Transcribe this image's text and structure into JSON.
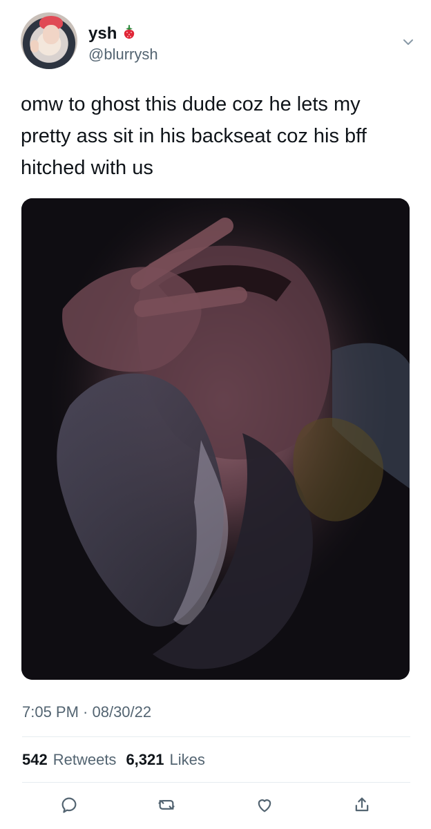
{
  "tweet": {
    "author": {
      "display_name": "ysh",
      "handle": "@blurrysh",
      "name_emoji": "🍓"
    },
    "text": "omw to ghost this dude coz he lets my pretty ass sit in his backseat coz his bff hitched with us",
    "timestamp": "7:05 PM · 08/30/22",
    "stats": {
      "retweets_count": "542",
      "retweets_label": "Retweets",
      "likes_count": "6,321",
      "likes_label": "Likes"
    },
    "actions": {
      "icons": [
        "reply-icon",
        "retweet-icon",
        "like-icon",
        "share-icon"
      ]
    }
  },
  "colors": {
    "text_primary": "#0f1419",
    "text_secondary": "#536471",
    "divider": "#e6ecf0"
  }
}
